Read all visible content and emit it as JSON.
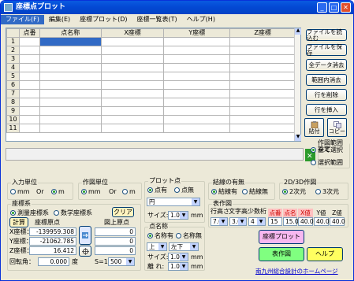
{
  "window": {
    "title": "座標点プロット"
  },
  "menu": [
    "ファイル(F)",
    "編集(E)",
    "座標プロット(D)",
    "座標一覧表(T)",
    "ヘルプ(H)"
  ],
  "grid": {
    "headers": [
      "",
      "点番",
      "点名称",
      "X座標",
      "Y座標",
      "Z座標"
    ],
    "rows": [
      "1",
      "2",
      "3",
      "4",
      "5",
      "6",
      "7",
      "8",
      "9",
      "10",
      "11"
    ]
  },
  "right_buttons": [
    "ファイルを読込む",
    "ファイルを保存",
    "全データ消去",
    "範囲内消去",
    "行を削除",
    "行を挿入"
  ],
  "icon_buttons": {
    "paste": "貼付",
    "copy": "コピー"
  },
  "range_setting": {
    "title": "作図範囲設定",
    "all": "全て選択",
    "select": "選択範囲"
  },
  "input_unit": {
    "title": "入力単位",
    "mm": "mm",
    "or": "Or",
    "m": "m"
  },
  "draw_unit": {
    "title": "作図単位",
    "mm": "mm",
    "or": "Or",
    "m": "m"
  },
  "plot_point": {
    "title": "プロット点",
    "yes": "点有",
    "no": "点無",
    "shape": "円",
    "size_label": "サイズ:",
    "size": "1.0",
    "unit": "mm"
  },
  "point_name": {
    "title": "点名称",
    "yes": "名称有",
    "no": "名称無",
    "pos1": "上",
    "pos2": "左下",
    "size_label": "サイズ:",
    "size": "1.0",
    "unit": "mm",
    "gap_label": "離 れ:",
    "gap": "1.0"
  },
  "connect": {
    "title": "結線の有無",
    "yes": "結線有",
    "no": "結線無"
  },
  "dim": {
    "title": "2D/3D作図",
    "d2": "2次元",
    "d3": "3次元"
  },
  "table_draw": {
    "title": "表作図",
    "row_height": "行高さ",
    "char_height": "文字高",
    "decimals": "少数桁",
    "rh": "7.0",
    "ch": "3.0",
    "dec": "4",
    "cols": [
      "点番",
      "点名",
      "X値",
      "Y値",
      "Z値"
    ],
    "widths": [
      "15",
      "15.0",
      "40.0",
      "40.0",
      "40.0"
    ]
  },
  "coord_sys": {
    "title": "座標系",
    "survey": "測量座標系",
    "math": "数学座標系",
    "clear": "クリア",
    "calc": "計算",
    "origin_label": "座標原点",
    "fig_origin": "図上原点",
    "x_label": "X座標：",
    "x": "-139959.308",
    "x2": "0",
    "y_label": "Y座標：",
    "y": "-21062.785",
    "y2": "0",
    "z_label": "Z座標：",
    "z": "16.412",
    "z2": "0",
    "rot_label": "回転角：",
    "rot": "0.000",
    "rot_unit": "度",
    "scale_label": "S=1:",
    "scale": "500"
  },
  "actions": {
    "plot": "座標プロット",
    "table": "表作図",
    "help": "ヘルプ"
  },
  "link": "南九州総合設計のホームページ"
}
